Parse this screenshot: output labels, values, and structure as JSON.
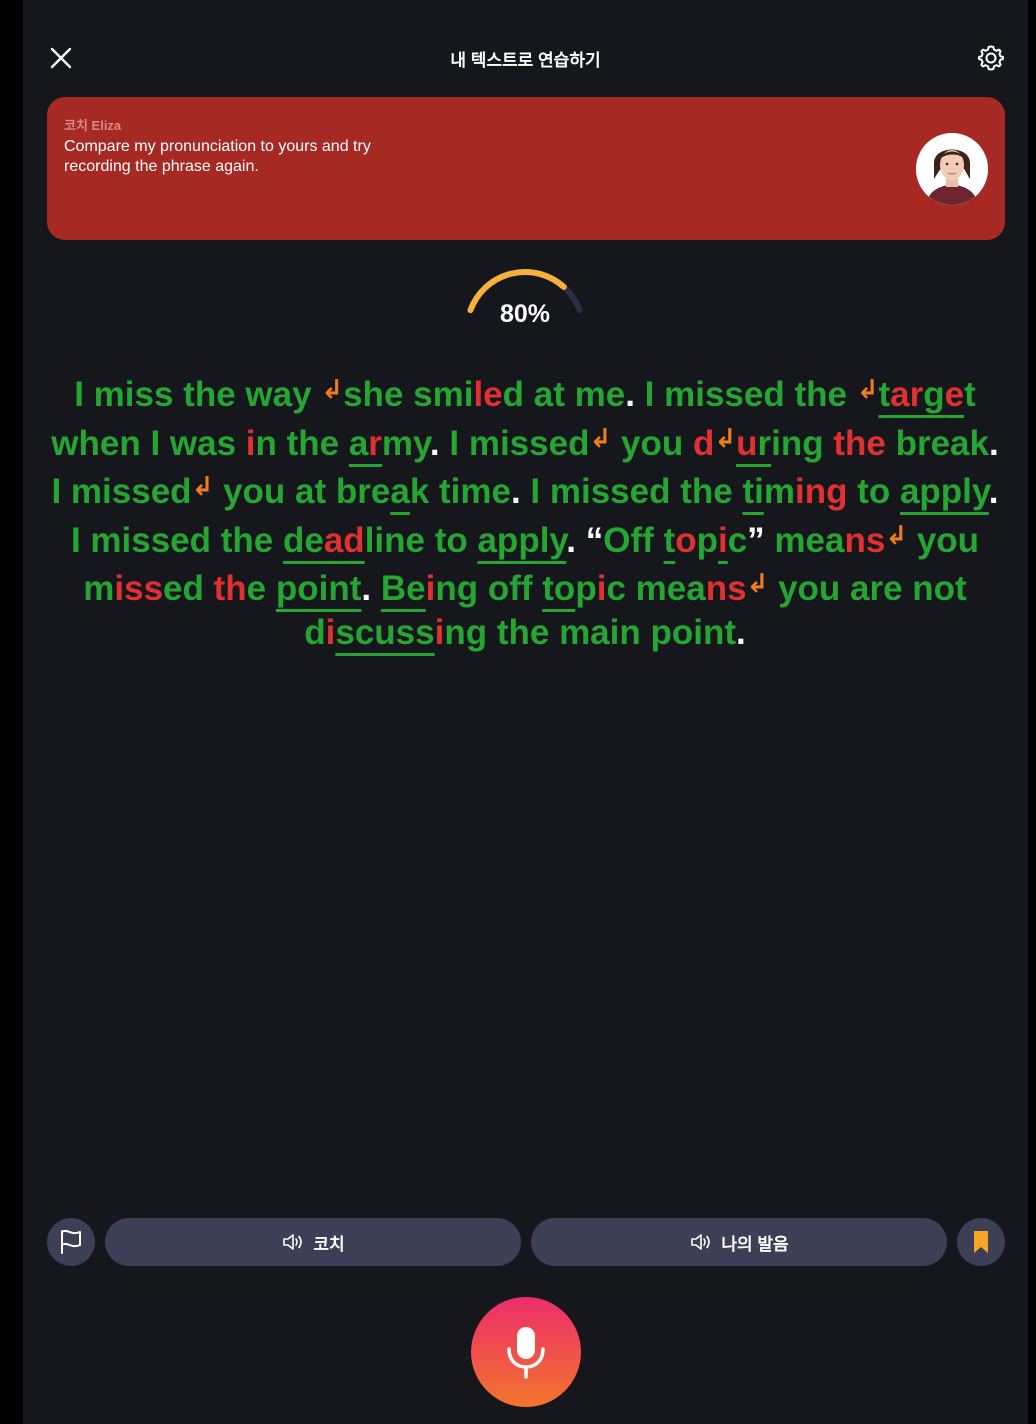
{
  "header": {
    "title": "내 텍스트로 연습하기"
  },
  "coach": {
    "name": "코치 Eliza",
    "message": "Compare my pronunciation to yours and try recording the phrase again."
  },
  "score": {
    "value_text": "80%",
    "fraction": 0.8
  },
  "colors": {
    "correct": "#25a632",
    "error": "#e0302f",
    "pause_arrow": "#ef7d1e",
    "card": "#a62924",
    "gauge": "#f4b23c"
  },
  "passage": [
    [
      "I miss the way ",
      "ok"
    ],
    [
      "↲",
      "arrow"
    ],
    [
      "she smi",
      "ok"
    ],
    [
      "le",
      "err"
    ],
    [
      "d at me",
      "ok"
    ],
    [
      ".",
      "pun"
    ],
    [
      " I missed the ",
      "ok"
    ],
    [
      "↲",
      "arrow"
    ],
    [
      "t",
      "ok",
      "ul"
    ],
    [
      "ar",
      "err",
      "ul"
    ],
    [
      "g",
      "ok",
      "ul"
    ],
    [
      "e",
      "err",
      "ul"
    ],
    [
      "t",
      "ok"
    ],
    [
      " when I was ",
      "ok"
    ],
    [
      "i",
      "err"
    ],
    [
      "n the ",
      "ok"
    ],
    [
      "a",
      "ok",
      "ul"
    ],
    [
      "r",
      "err",
      "ul"
    ],
    [
      "my",
      "ok"
    ],
    [
      ".",
      "pun"
    ],
    [
      " I missed",
      "ok"
    ],
    [
      "↲",
      "arrow"
    ],
    [
      " you ",
      "ok"
    ],
    [
      "d",
      "err"
    ],
    [
      "↲",
      "arrow"
    ],
    [
      "u",
      "err",
      "ul"
    ],
    [
      "r",
      "ok",
      "ul"
    ],
    [
      "ing ",
      "ok"
    ],
    [
      "the",
      "err"
    ],
    [
      " break",
      "ok"
    ],
    [
      ".",
      "pun"
    ],
    [
      " I missed",
      "ok"
    ],
    [
      "↲",
      "arrow"
    ],
    [
      " you at bre",
      "ok"
    ],
    [
      "a",
      "ok",
      "ul"
    ],
    [
      "k time",
      "ok"
    ],
    [
      ".",
      "pun"
    ],
    [
      " I missed the ",
      "ok"
    ],
    [
      "ti",
      "ok",
      "ul"
    ],
    [
      "m",
      "ok"
    ],
    [
      "ing",
      "err"
    ],
    [
      " to ",
      "ok"
    ],
    [
      "apply",
      "ok",
      "ul"
    ],
    [
      ".",
      "pun"
    ],
    [
      " I missed the ",
      "ok"
    ],
    [
      "de",
      "ok",
      "ul"
    ],
    [
      "ad",
      "err",
      "ul"
    ],
    [
      "line to ",
      "ok"
    ],
    [
      "apply",
      "ok",
      "ul"
    ],
    [
      ".",
      "pun"
    ],
    [
      " “",
      "pun"
    ],
    [
      "Off ",
      "ok"
    ],
    [
      "t",
      "ok",
      "ul"
    ],
    [
      "o",
      "err"
    ],
    [
      "p",
      "ok"
    ],
    [
      "i",
      "err",
      "ul"
    ],
    [
      "c",
      "ok"
    ],
    [
      "”",
      "pun"
    ],
    [
      " mea",
      "ok"
    ],
    [
      "ns",
      "err"
    ],
    [
      "↲",
      "arrow"
    ],
    [
      " you ",
      "ok"
    ],
    [
      "m",
      "ok"
    ],
    [
      "iss",
      "err"
    ],
    [
      "ed ",
      "ok"
    ],
    [
      "th",
      "err"
    ],
    [
      "e ",
      "ok"
    ],
    [
      "point",
      "ok",
      "ul"
    ],
    [
      ".",
      "pun"
    ],
    [
      " ",
      "ok"
    ],
    [
      "Be",
      "ok",
      "ul"
    ],
    [
      "i",
      "err"
    ],
    [
      "ng off ",
      "ok"
    ],
    [
      "to",
      "ok",
      "ul"
    ],
    [
      "p",
      "ok"
    ],
    [
      "i",
      "err"
    ],
    [
      "c mea",
      "ok"
    ],
    [
      "ns",
      "err"
    ],
    [
      "↲",
      "arrow"
    ],
    [
      " you are not d",
      "ok"
    ],
    [
      "i",
      "err"
    ],
    [
      "scuss",
      "ok",
      "ul"
    ],
    [
      "i",
      "err"
    ],
    [
      "ng the main point",
      "ok"
    ],
    [
      ".",
      "pun"
    ]
  ],
  "controls": {
    "coach_audio_label": "코치",
    "my_audio_label": "나의 발음"
  }
}
